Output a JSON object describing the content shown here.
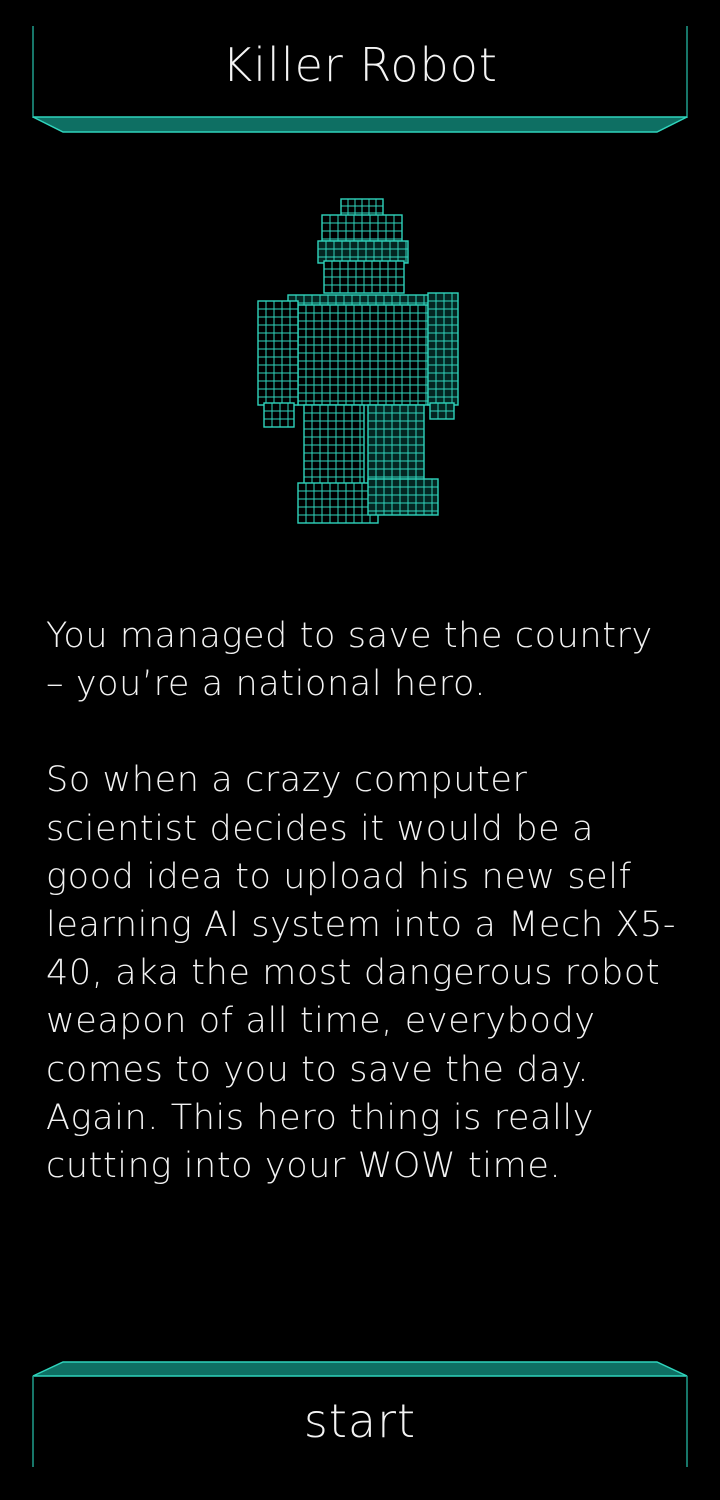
{
  "header": {
    "title": "Killer Robot"
  },
  "story": {
    "paragraphs": [
      "You managed to save the country – you’re a national hero.",
      "So when a crazy computer scientist decides it would be a good idea to upload his new self learning AI system into a Mech X5-40, aka the most dangerous robot weapon of all time, everybody comes to you to save the day. Again. This hero thing is really cutting into your WOW time."
    ]
  },
  "footer": {
    "start_label": "start"
  },
  "colors": {
    "background": "#000000",
    "accent": "#2fd4bc",
    "accent_dark": "#0e6f63",
    "text": "#f2f2f2"
  },
  "icons": {
    "robot": "voxel-robot-icon"
  }
}
